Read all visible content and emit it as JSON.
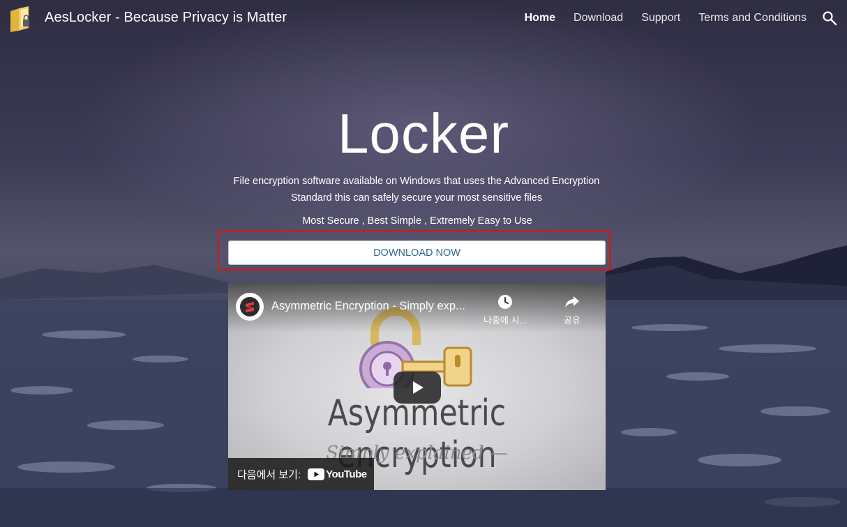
{
  "header": {
    "brand": "AesLocker - Because Privacy is Matter",
    "nav": [
      {
        "label": "Home"
      },
      {
        "label": "Download"
      },
      {
        "label": "Support"
      },
      {
        "label": "Terms and Conditions"
      }
    ]
  },
  "hero": {
    "title": "Locker",
    "description": "File encryption software available on Windows that uses the Advanced Encryption Standard this can safely secure your most sensitive files",
    "tagline": "Most Secure , Best Simple , Extremely Easy to Use",
    "download_label": "DOWNLOAD NOW"
  },
  "video": {
    "title": "Asymmetric Encryption - Simply exp...",
    "watch_later": "나중에 시...",
    "share": "공유",
    "art_title": "Asymmetric encryption",
    "art_subtitle": "Simply explained —",
    "watch_on": "다음에서 보기:",
    "youtube_label": "YouTube"
  },
  "colors": {
    "highlight": "#e01010",
    "button_text": "#2d6a8c"
  }
}
